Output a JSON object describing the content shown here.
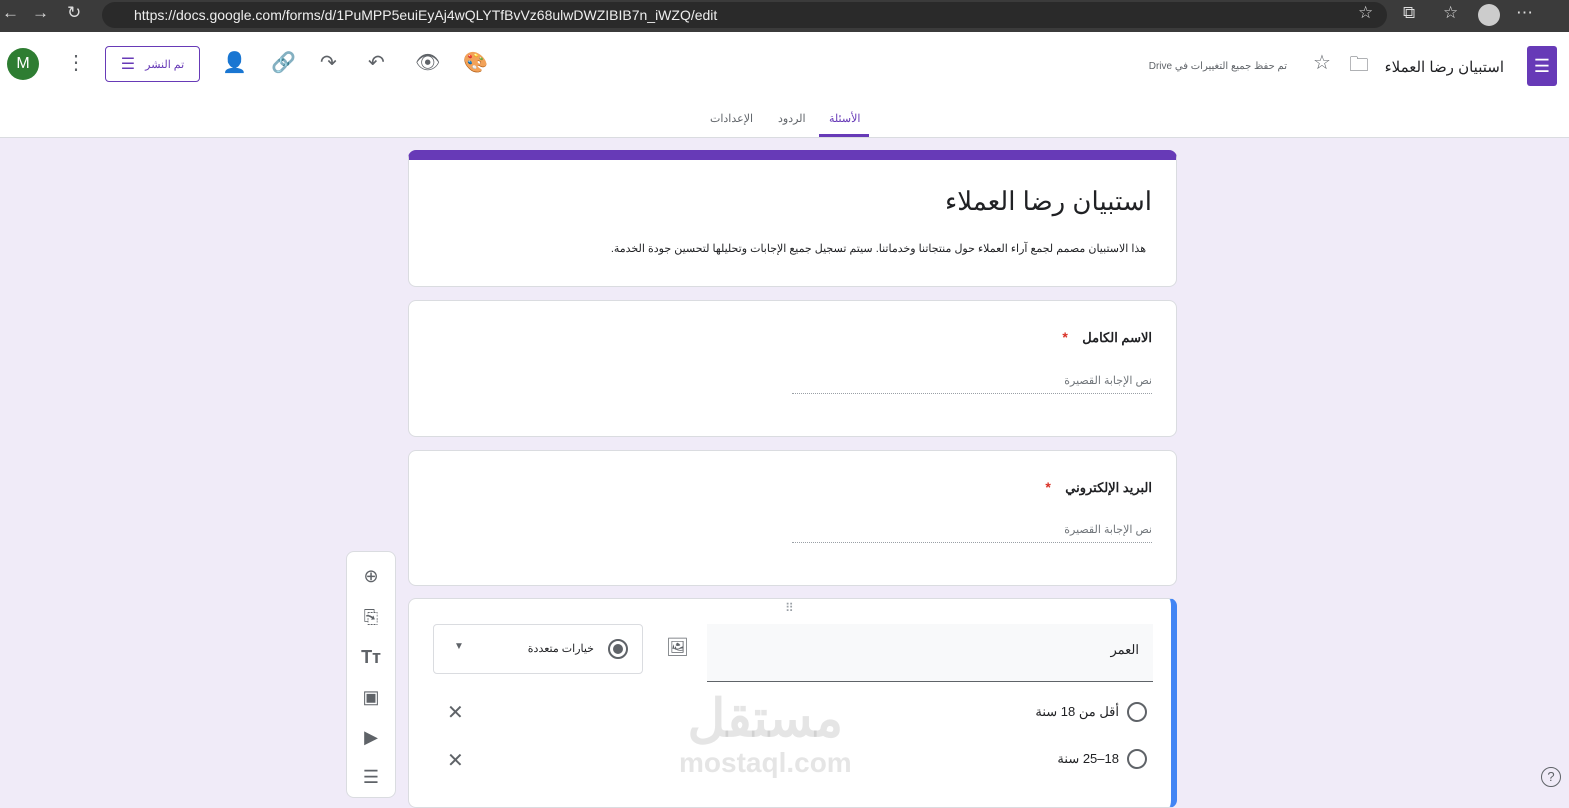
{
  "browser": {
    "url": "https://docs.google.com/forms/d/1PuMPP5euiEyAj4wQLYTfBvVz68ulwDWZIBIB7n_iWZQ/edit"
  },
  "header": {
    "avatar": "M",
    "publish_label": "تم النشر",
    "saved_status": "تم حفظ جميع التغييرات في Drive",
    "doc_title": "استبيان رضا العملاء"
  },
  "tabs": [
    "الأسئلة",
    "الردود",
    "الإعدادات"
  ],
  "form": {
    "title": "استبيان رضا العملاء",
    "description": "هذا الاستبيان مصمم لجمع آراء العملاء حول منتجاتنا وخدماتنا. سيتم تسجيل جميع الإجابات وتحليلها لتحسين جودة الخدمة."
  },
  "questions": [
    {
      "title": "الاسم الكامل",
      "required": "*",
      "placeholder": "نص الإجابة القصيرة"
    },
    {
      "title": "البريد الإلكتروني",
      "required": "*",
      "placeholder": "نص الإجابة القصيرة"
    }
  ],
  "active_question": {
    "title": "العمر",
    "type": "خيارات متعددة",
    "options": [
      "أقل من 18 سنة",
      "18–25 سنة"
    ]
  },
  "watermark": {
    "text": "مستقل",
    "sub": "mostaql.com"
  }
}
